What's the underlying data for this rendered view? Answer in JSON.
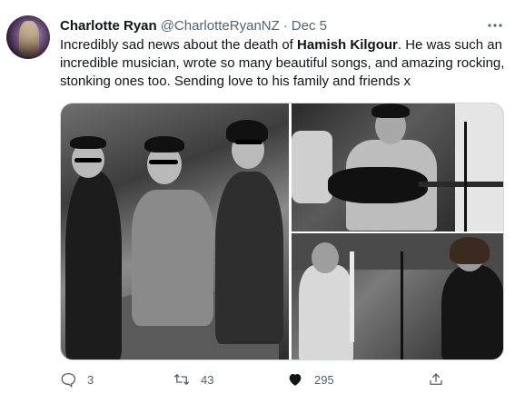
{
  "tweet": {
    "author_name": "Charlotte Ryan",
    "handle": "@CharlotteRyanNZ",
    "separator": "·",
    "date": "Dec 5",
    "text_before": "Incredibly sad news about the death of ",
    "text_bold": "Hamish Kilgour",
    "text_after": ". He was such an incredible musician, wrote so many beautiful songs, and amazing rocking, stonking ones too. Sending love to his family and friends x"
  },
  "media": {
    "icons": [
      "band-photo",
      "guitarist-photo",
      "studio-photo"
    ]
  },
  "actions": {
    "replies": "3",
    "retweets": "43",
    "likes": "295"
  },
  "icons": {
    "more": "more-icon",
    "reply": "reply-icon",
    "retweet": "retweet-icon",
    "like": "heart-icon",
    "share": "share-icon"
  },
  "colors": {
    "text": "#0f1419",
    "secondary": "#536471",
    "border": "#cfd9de"
  }
}
